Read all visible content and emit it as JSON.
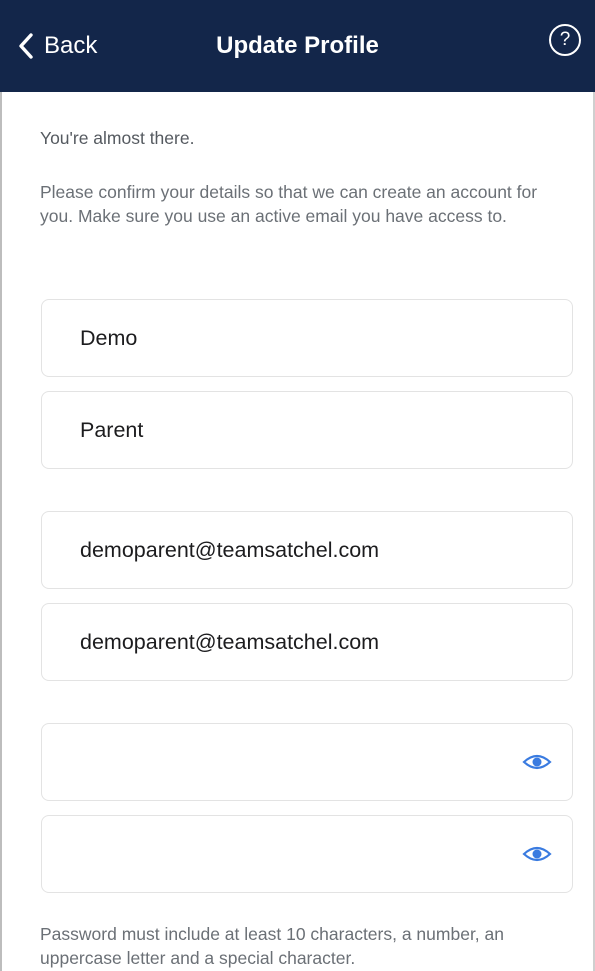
{
  "navbar": {
    "back_label": "Back",
    "title": "Update Profile",
    "help_label": "?"
  },
  "intro_text": "You're almost there.",
  "description": "Please confirm your details so that we can create an account for you. Make sure you use an active email you have access to.",
  "form": {
    "first_name": "Demo",
    "last_name": "Parent",
    "email": "demoparent@teamsatchel.com",
    "confirm_email": "demoparent@teamsatchel.com",
    "password": "",
    "confirm_password": ""
  },
  "password_hint": "Password must include at least 10 characters, a number, an uppercase letter and a special character.",
  "icons": {
    "back": "chevron-left-icon",
    "help": "question-circle-icon",
    "password_toggle": "eye-icon"
  },
  "colors": {
    "navbar_bg": "#13264a",
    "accent": "#3a7be0",
    "field_border": "#e3e3e3",
    "body_text": "#6b7076"
  }
}
